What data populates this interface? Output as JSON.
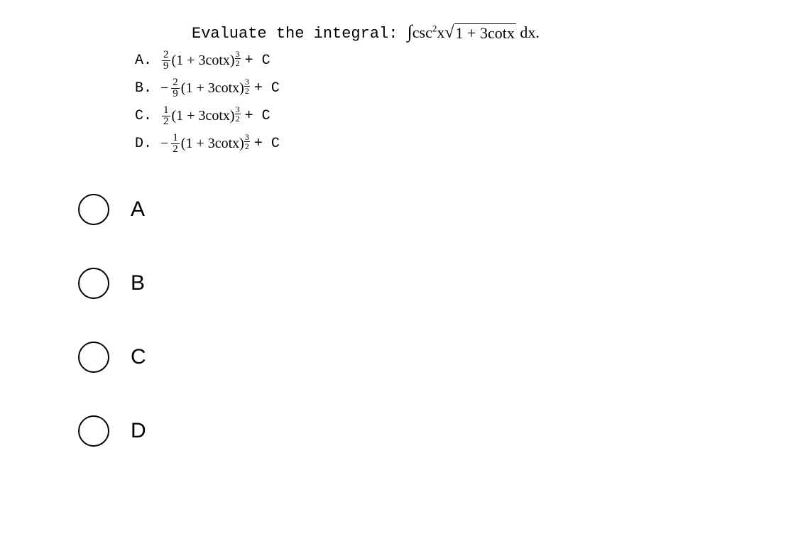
{
  "question": {
    "prompt": "Evaluate the integral:",
    "integral_prefix": "∫",
    "integrand_part1": "csc",
    "integrand_exp": "2",
    "integrand_part2": "x",
    "sqrt_content": "1 + 3cotx",
    "dx": " dx."
  },
  "answers": {
    "a": {
      "label": "A.",
      "sign": "",
      "frac_num": "2",
      "frac_den": "9",
      "base": "(1 + 3cotx)",
      "exp_num": "3",
      "exp_den": "2",
      "suffix": " + C"
    },
    "b": {
      "label": "B.",
      "sign": "−",
      "frac_num": "2",
      "frac_den": "9",
      "base": "(1 + 3cotx)",
      "exp_num": "3",
      "exp_den": "2",
      "suffix": " + C"
    },
    "c": {
      "label": "C.",
      "sign": "",
      "frac_num": "1",
      "frac_den": "2",
      "base": "(1 + 3cotx)",
      "exp_num": "3",
      "exp_den": "2",
      "suffix": " + C"
    },
    "d": {
      "label": "D.",
      "sign": "−",
      "frac_num": "1",
      "frac_den": "2",
      "base": "(1 + 3cotx)",
      "exp_num": "3",
      "exp_den": "2",
      "suffix": " + C"
    }
  },
  "options": {
    "a": "A",
    "b": "B",
    "c": "C",
    "d": "D"
  }
}
